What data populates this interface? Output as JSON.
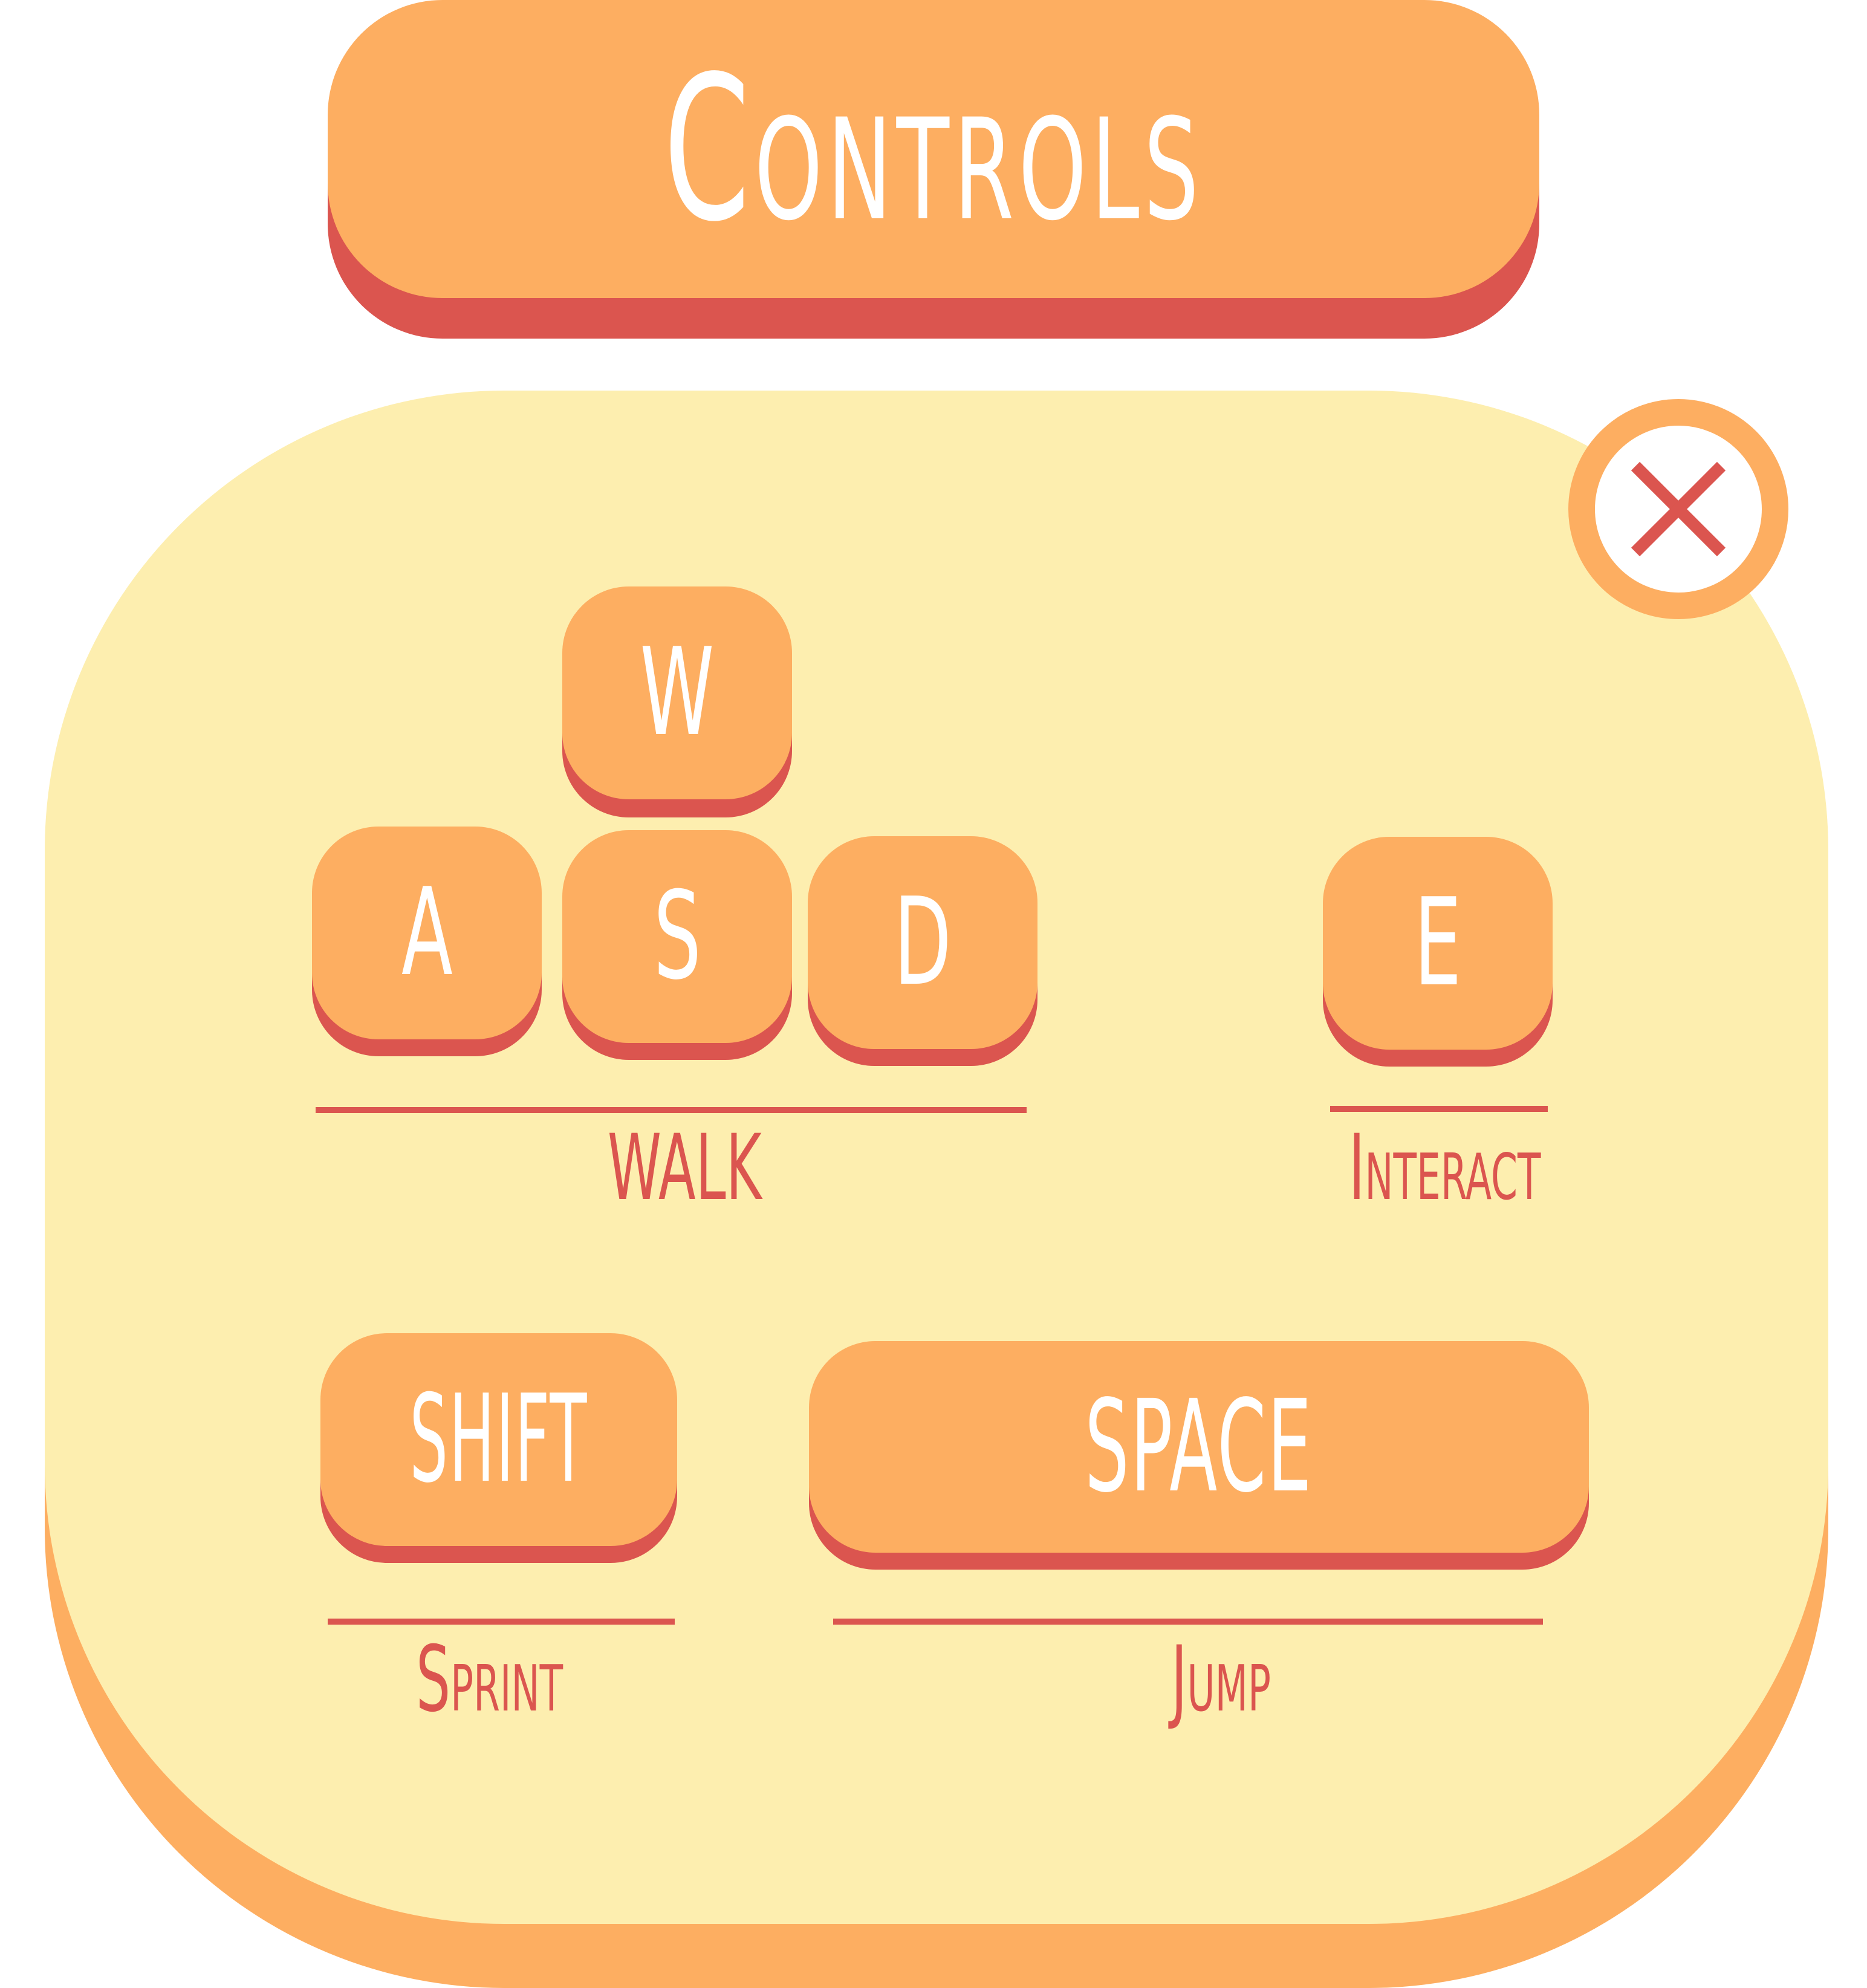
{
  "title": "Controls",
  "close_button": {
    "icon": "close-icon"
  },
  "keys": {
    "w": "W",
    "a": "A",
    "s": "S",
    "d": "D",
    "e": "E",
    "shift": "SHIFT",
    "space": "SPACE"
  },
  "actions": {
    "walk": "WALK",
    "interact": "Interact",
    "sprint": "Sprint",
    "jump": "Jump"
  },
  "colors": {
    "orange": "#fdae61",
    "red": "#db554f",
    "cream": "#fdeeaf",
    "white": "#ffffff"
  }
}
